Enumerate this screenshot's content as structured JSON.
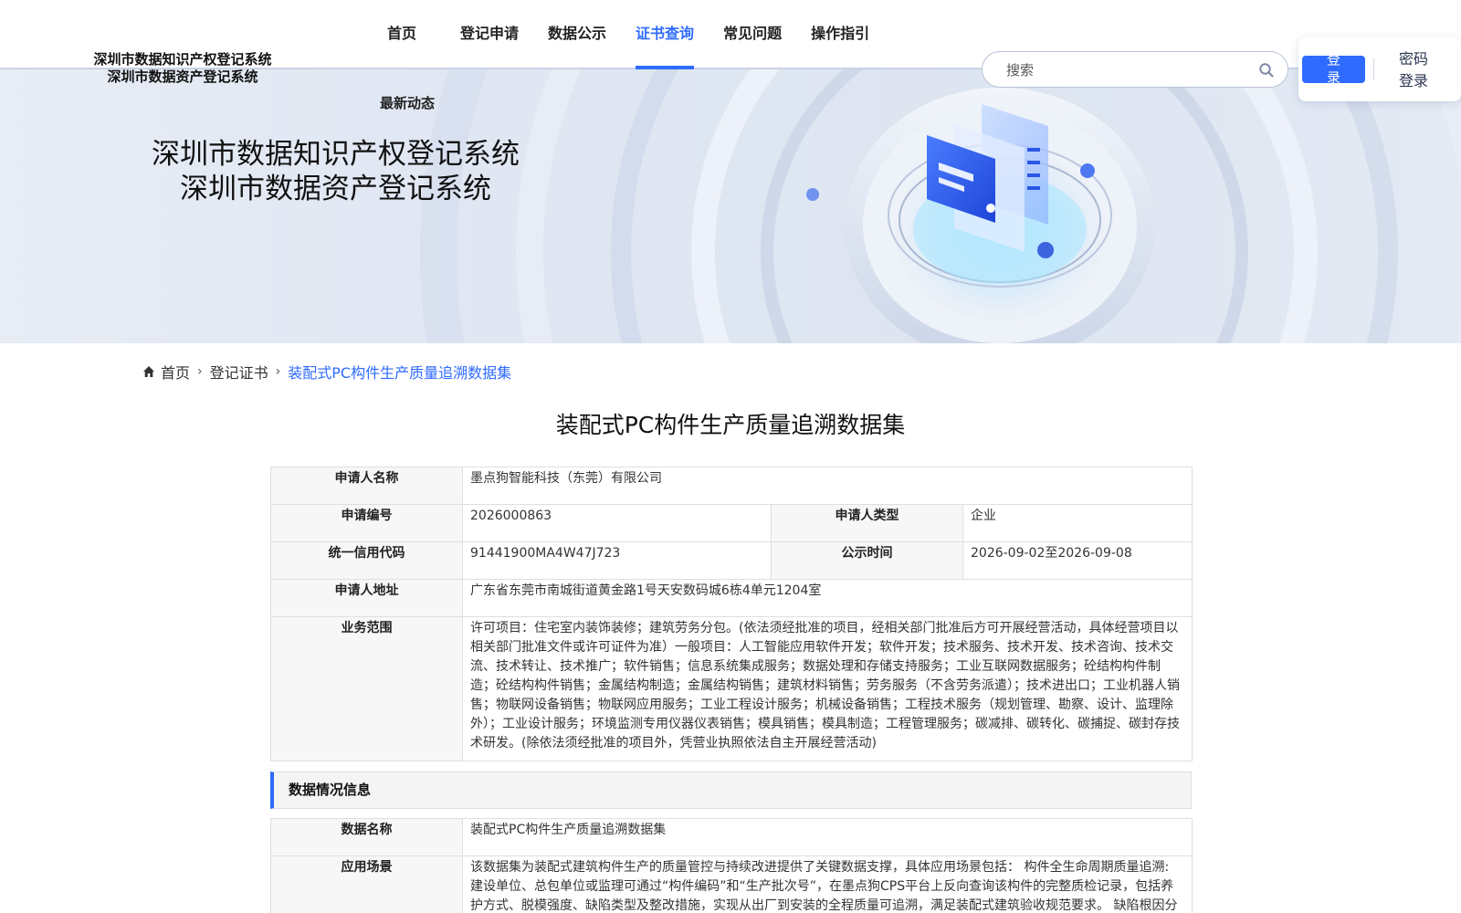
{
  "header": {
    "logo_line1": "深圳市数据知识产权登记系统",
    "logo_line2": "深圳市数据资产登记系统",
    "nav": [
      {
        "label": "首页",
        "active": false
      },
      {
        "label": "登记申请",
        "active": false
      },
      {
        "label": "数据公示",
        "active": false
      },
      {
        "label": "证书查询",
        "active": true
      },
      {
        "label": "常见问题",
        "active": false
      },
      {
        "label": "操作指引",
        "active": false
      }
    ],
    "nav_sub": "最新动态",
    "search_placeholder": "搜索",
    "login_label": "登录",
    "password_login_label": "密码登录"
  },
  "banner": {
    "title_line1": "深圳市数据知识产权登记系统",
    "title_line2": "深圳市数据资产登记系统"
  },
  "breadcrumb": {
    "home": "首页",
    "level2": "登记证书",
    "current": "装配式PC构件生产质量追溯数据集"
  },
  "page_title": "装配式PC构件生产质量追溯数据集",
  "applicant": {
    "name_label": "申请人名称",
    "name_value": "墨点狗智能科技（东莞）有限公司",
    "number_label": "申请编号",
    "number_value": "2026000863",
    "type_label": "申请人类型",
    "type_value": "企业",
    "credit_label": "统一信用代码",
    "credit_value": "91441900MA4W47J723",
    "publicity_label": "公示时间",
    "publicity_value": "2026-09-02至2026-09-08",
    "address_label": "申请人地址",
    "address_value": "广东省东莞市南城街道黄金路1号天安数码城6栋4单元1204室",
    "scope_label": "业务范围",
    "scope_value": "许可项目：住宅室内装饰装修；建筑劳务分包。(依法须经批准的项目，经相关部门批准后方可开展经营活动，具体经营项目以相关部门批准文件或许可证件为准）一般项目：人工智能应用软件开发；软件开发；技术服务、技术开发、技术咨询、技术交流、技术转让、技术推广；软件销售；信息系统集成服务；数据处理和存储支持服务；工业互联网数据服务；砼结构构件制造；砼结构构件销售；金属结构制造；金属结构销售；建筑材料销售；劳务服务（不含劳务派遣）；技术进出口；工业机器人销售；物联网设备销售；物联网应用服务；工业工程设计服务；机械设备销售；工程技术服务（规划管理、勘察、设计、监理除外）；工业设计服务；环境监测专用仪器仪表销售；模具销售；模具制造；工程管理服务；碳减排、碳转化、碳捕捉、碳封存技术研发。(除依法须经批准的项目外，凭营业执照依法自主开展经营活动)"
  },
  "data_section": {
    "heading": "数据情况信息",
    "data_name_label": "数据名称",
    "data_name_value": "装配式PC构件生产质量追溯数据集",
    "scenario_label": "应用场景",
    "scenario_value": "该数据集为装配式建筑构件生产的质量管控与持续改进提供了关键数据支撑，具体应用场景包括： 构件全生命周期质量追溯: 建设单位、总包单位或监理可通过“构件编码”和“生产批次号”，在墨点狗CPS平台上反向查询该构件的完整质检记录，包括养护方式、脱模强度、缺陷类型及整改措施，实现从出厂到安装的全程质量可追溯，满足装配式建筑验收规范要求。 缺陷根因分析"
  },
  "colors": {
    "accent": "#2f6bff",
    "label_bg": "#f7f7f7",
    "border": "#dcdfe6"
  }
}
